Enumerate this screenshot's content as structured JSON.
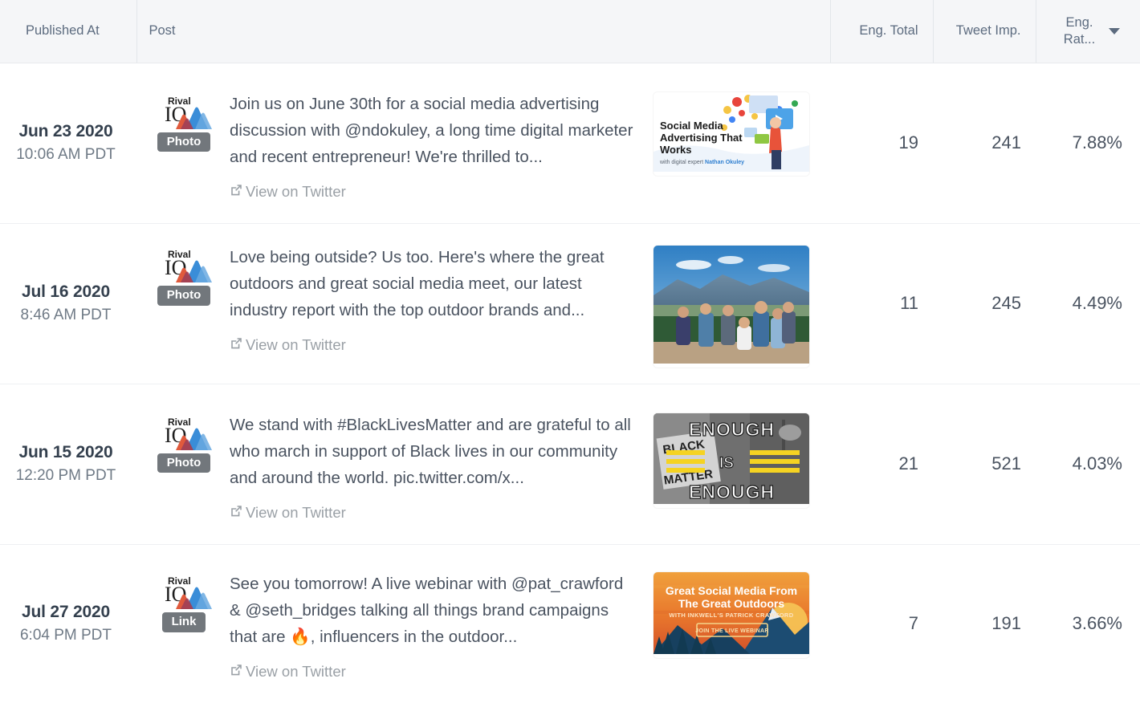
{
  "table": {
    "columns": [
      {
        "key": "published_at",
        "label": "Published At"
      },
      {
        "key": "post",
        "label": "Post"
      },
      {
        "key": "eng_total",
        "label": "Eng. Total"
      },
      {
        "key": "tweet_imp",
        "label": "Tweet Imp."
      },
      {
        "key": "eng_rate",
        "label_line1": "Eng.",
        "label_line2": "Rat...",
        "sort_icon": "caret-down-icon",
        "sorted": true,
        "sort_direction": "desc"
      }
    ],
    "view_link_label": "View on Twitter",
    "view_link_icon": "external-link-icon",
    "brand_logo": "rival-iq-logo",
    "rows": [
      {
        "date": "Jun 23 2020",
        "time": "10:06 AM PDT",
        "type_badge": "Photo",
        "text": "Join us on June 30th for a social media advertising discussion with @ndokuley, a long time digital marketer and recent entrepreneur! We're thrilled to...",
        "eng_total": "19",
        "tweet_imp": "241",
        "eng_rate": "7.88%",
        "thumbnail": {
          "kind": "webinar-graphic",
          "title_line1": "Social Media",
          "title_line2": "Advertising That",
          "title_line3": "Works",
          "subtitle_plain": "with digital expert ",
          "subtitle_accent": "Nathan Okuley"
        }
      },
      {
        "date": "Jul 16 2020",
        "time": "8:46 AM PDT",
        "type_badge": "Photo",
        "text": "Love being outside? Us too. Here's where the great outdoors and great social media meet, our latest industry report with the top outdoor brands and...",
        "eng_total": "11",
        "tweet_imp": "245",
        "eng_rate": "4.49%",
        "thumbnail": {
          "kind": "outdoor-group-photo"
        }
      },
      {
        "date": "Jun 15 2020",
        "time": "12:20 PM PDT",
        "type_badge": "Photo",
        "text": "We stand with #BlackLivesMatter and are grateful to all who march in support of Black lives in our community and around the world. pic.twitter.com/x...",
        "eng_total": "21",
        "tweet_imp": "521",
        "eng_rate": "4.03%",
        "thumbnail": {
          "kind": "enough-is-enough-graphic",
          "word1": "ENOUGH",
          "word2": "IS",
          "word3": "ENOUGH",
          "background_text1": "BLACK",
          "background_text2": "MATTER"
        }
      },
      {
        "date": "Jul 27 2020",
        "time": "6:04 PM PDT",
        "type_badge": "Link",
        "text": "See you tomorrow! A live webinar with @pat_crawford & @seth_bridges talking all things brand campaigns that are 🔥, influencers in the outdoor...",
        "eng_total": "7",
        "tweet_imp": "191",
        "eng_rate": "3.66%",
        "thumbnail": {
          "kind": "great-outdoors-graphic",
          "title_line1": "Great Social Media From",
          "title_line2": "The Great Outdoors",
          "subtitle": "WITH INKWELL'S PATRICK CRAWFORD",
          "button_label": "JOIN THE LIVE WEBINAR"
        }
      }
    ]
  },
  "colors": {
    "header_bg": "#f5f6f8",
    "header_text": "#5c6b7f",
    "body_text": "#4a5360",
    "date_text": "#34404e",
    "muted_text": "#6f7a86",
    "link_text": "#9aa0a6",
    "badge_bg": "#72777c",
    "row_divider": "#eef0f2",
    "logo_blue": "#3a8dd8",
    "logo_red": "#e05a3c"
  }
}
